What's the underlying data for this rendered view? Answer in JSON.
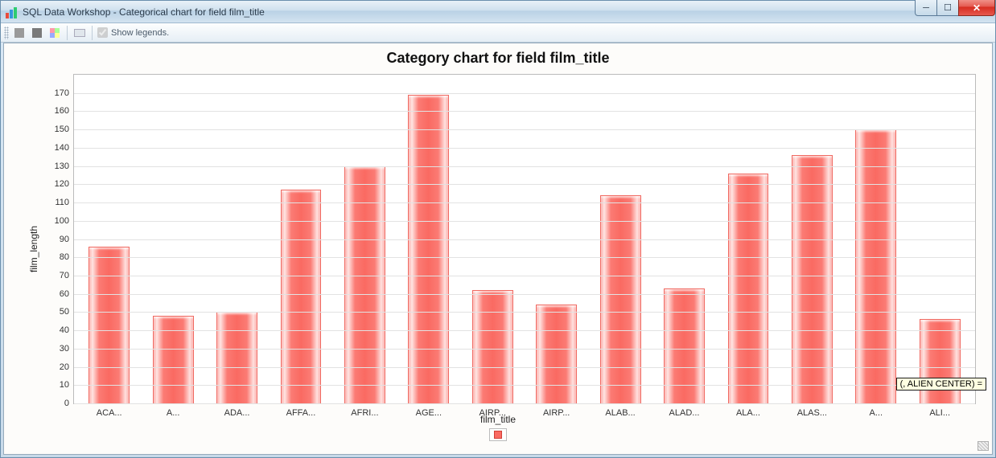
{
  "window": {
    "title": "SQL Data Workshop - Categorical chart for field film_title"
  },
  "toolbar": {
    "show_legends_label": "Show legends.",
    "show_legends_checked": true
  },
  "tooltip": "(, ALIEN CENTER) =",
  "chart_data": {
    "type": "bar",
    "title": "Category chart for field film_title",
    "xlabel": "film_title",
    "ylabel": "film_length",
    "ylim": [
      0,
      180
    ],
    "yticks": [
      0,
      10,
      20,
      30,
      40,
      50,
      60,
      70,
      80,
      90,
      100,
      110,
      120,
      130,
      140,
      150,
      160,
      170
    ],
    "categories_display": [
      "ACA...",
      "A...",
      "ADA...",
      "AFFA...",
      "AFRI...",
      "AGE...",
      "AIRP...",
      "AIRP...",
      "ALAB...",
      "ALAD...",
      "ALA...",
      "ALAS...",
      "A...",
      "ALI..."
    ],
    "values": [
      86,
      48,
      50,
      117,
      130,
      169,
      62,
      54,
      114,
      63,
      126,
      136,
      150,
      46
    ]
  }
}
